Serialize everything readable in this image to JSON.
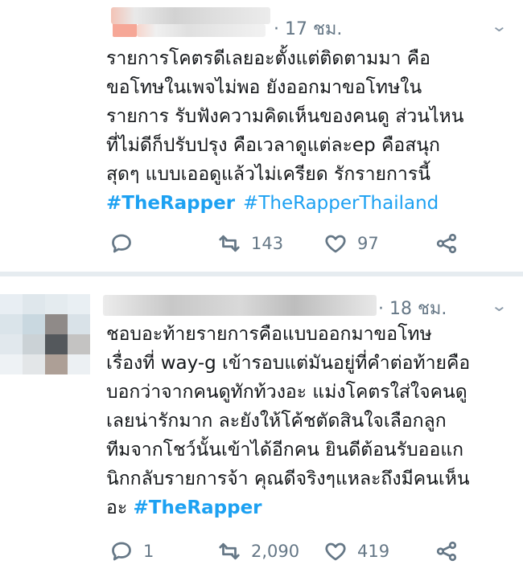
{
  "tweets": [
    {
      "time": "· 17 ชม.",
      "lines": [
        "รายการโคตรดีเลยอะตั้งแต่ติดตามมา คือ",
        "ขอโทษในเพจไม่พอ ยังออกมาขอโทษใน",
        "รายการ รับฟังความคิดเห็นของคนดู ส่วนไหน",
        "ที่ไม่ดีก็ปรับปรุง คือเวลาดูแต่ละep คือสนุก",
        "สุดๆ แบบเออดูแล้วไม่เครียด รักรายการนี้"
      ],
      "hashtags": [
        "#TheRapper",
        "#TheRapperThailand"
      ],
      "replies": "",
      "retweets": "143",
      "likes": "97"
    },
    {
      "time": "· 18 ชม.",
      "lines": [
        "ชอบอะท้ายรายการคือแบบออกมาขอโทษ",
        "เรื่องที่ way-g เข้ารอบแต่มันอยู่ที่คำต่อท้ายคือ",
        "บอกว่าจากคนดูทักท้วงอะ แม่งโคตรใส่ใจคนดู",
        "เลยน่ารักมาก ละยังให้โค้ชตัดสินใจเลือกลูก",
        "ทีมจากโชว์นั้นเข้าได้อีกคน ยินดีต้อนรับออแก",
        "นิกกลับรายการจ้า คุณดีจริงๆแหละถึงมีคนเห็น"
      ],
      "last_line_prefix": "อะ",
      "hashtags": [
        "#TheRapper"
      ],
      "replies": "1",
      "retweets": "2,090",
      "likes": "419"
    }
  ],
  "icons": [
    "reply-icon",
    "retweet-icon",
    "like-icon",
    "share-icon",
    "chevron-down-icon"
  ],
  "colors": {
    "hashtag": "#1da1f2",
    "meta": "#657786",
    "divider": "#e6ecf0"
  }
}
